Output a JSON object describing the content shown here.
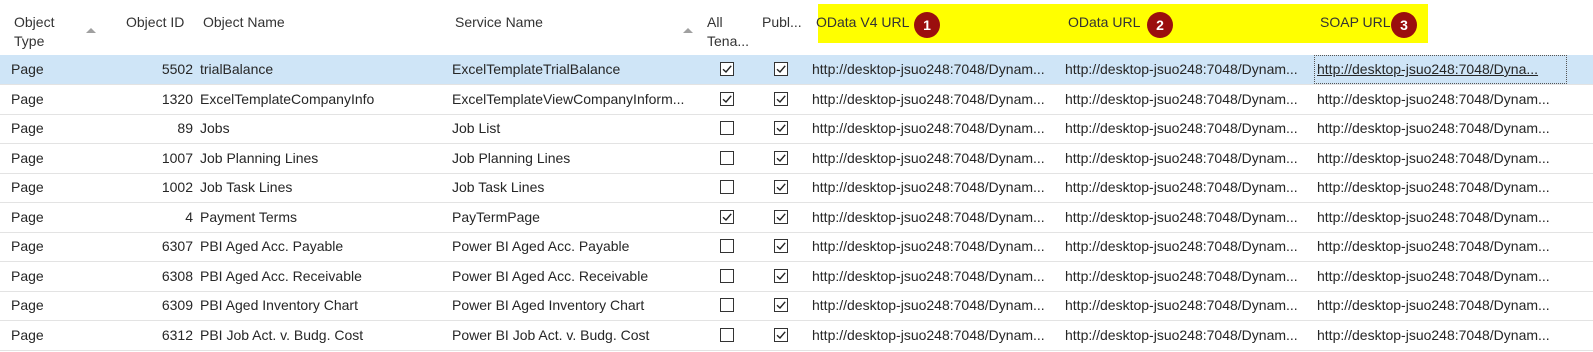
{
  "headers": {
    "object_type": "Object\nType",
    "object_id": "Object ID",
    "object_name": "Object Name",
    "service_name": "Service Name",
    "all_tenants": "All\nTena...",
    "published": "Publ...",
    "odata_v4_url": "OData V4 URL",
    "odata_url": "OData URL",
    "soap_url": "SOAP URL"
  },
  "badges": [
    "1",
    "2",
    "3"
  ],
  "highlight_color": "#ffff00",
  "badge_color": "#9b0e0e",
  "selected_row_color": "#cfe5f7",
  "rows": [
    {
      "type": "Page",
      "id": "5502",
      "name": "trialBalance",
      "service": "ExcelTemplateTrialBalance",
      "all_tenants": true,
      "published": true,
      "odata_v4": "http://desktop-jsuo248:7048/Dynam...",
      "odata": "http://desktop-jsuo248:7048/Dynam...",
      "soap": "http://desktop-jsuo248:7048/Dyna...",
      "selected": true
    },
    {
      "type": "Page",
      "id": "1320",
      "name": "ExcelTemplateCompanyInfo",
      "service": "ExcelTemplateViewCompanyInform...",
      "all_tenants": true,
      "published": true,
      "odata_v4": "http://desktop-jsuo248:7048/Dynam...",
      "odata": "http://desktop-jsuo248:7048/Dynam...",
      "soap": "http://desktop-jsuo248:7048/Dynam...",
      "selected": false
    },
    {
      "type": "Page",
      "id": "89",
      "name": "Jobs",
      "service": "Job List",
      "all_tenants": false,
      "published": true,
      "odata_v4": "http://desktop-jsuo248:7048/Dynam...",
      "odata": "http://desktop-jsuo248:7048/Dynam...",
      "soap": "http://desktop-jsuo248:7048/Dynam...",
      "selected": false
    },
    {
      "type": "Page",
      "id": "1007",
      "name": "Job Planning Lines",
      "service": "Job Planning Lines",
      "all_tenants": false,
      "published": true,
      "odata_v4": "http://desktop-jsuo248:7048/Dynam...",
      "odata": "http://desktop-jsuo248:7048/Dynam...",
      "soap": "http://desktop-jsuo248:7048/Dynam...",
      "selected": false
    },
    {
      "type": "Page",
      "id": "1002",
      "name": "Job Task Lines",
      "service": "Job Task Lines",
      "all_tenants": false,
      "published": true,
      "odata_v4": "http://desktop-jsuo248:7048/Dynam...",
      "odata": "http://desktop-jsuo248:7048/Dynam...",
      "soap": "http://desktop-jsuo248:7048/Dynam...",
      "selected": false
    },
    {
      "type": "Page",
      "id": "4",
      "name": "Payment Terms",
      "service": "PayTermPage",
      "all_tenants": true,
      "published": true,
      "odata_v4": "http://desktop-jsuo248:7048/Dynam...",
      "odata": "http://desktop-jsuo248:7048/Dynam...",
      "soap": "http://desktop-jsuo248:7048/Dynam...",
      "selected": false
    },
    {
      "type": "Page",
      "id": "6307",
      "name": "PBI Aged Acc. Payable",
      "service": "Power BI Aged Acc. Payable",
      "all_tenants": false,
      "published": true,
      "odata_v4": "http://desktop-jsuo248:7048/Dynam...",
      "odata": "http://desktop-jsuo248:7048/Dynam...",
      "soap": "http://desktop-jsuo248:7048/Dynam...",
      "selected": false
    },
    {
      "type": "Page",
      "id": "6308",
      "name": "PBI Aged Acc. Receivable",
      "service": "Power BI Aged Acc. Receivable",
      "all_tenants": false,
      "published": true,
      "odata_v4": "http://desktop-jsuo248:7048/Dynam...",
      "odata": "http://desktop-jsuo248:7048/Dynam...",
      "soap": "http://desktop-jsuo248:7048/Dynam...",
      "selected": false
    },
    {
      "type": "Page",
      "id": "6309",
      "name": "PBI Aged Inventory Chart",
      "service": "Power BI Aged Inventory Chart",
      "all_tenants": false,
      "published": true,
      "odata_v4": "http://desktop-jsuo248:7048/Dynam...",
      "odata": "http://desktop-jsuo248:7048/Dynam...",
      "soap": "http://desktop-jsuo248:7048/Dynam...",
      "selected": false
    },
    {
      "type": "Page",
      "id": "6312",
      "name": "PBI Job Act. v. Budg. Cost",
      "service": "Power BI Job Act. v. Budg. Cost",
      "all_tenants": false,
      "published": true,
      "odata_v4": "http://desktop-jsuo248:7048/Dynam...",
      "odata": "http://desktop-jsuo248:7048/Dynam...",
      "soap": "http://desktop-jsuo248:7048/Dynam...",
      "selected": false
    }
  ]
}
